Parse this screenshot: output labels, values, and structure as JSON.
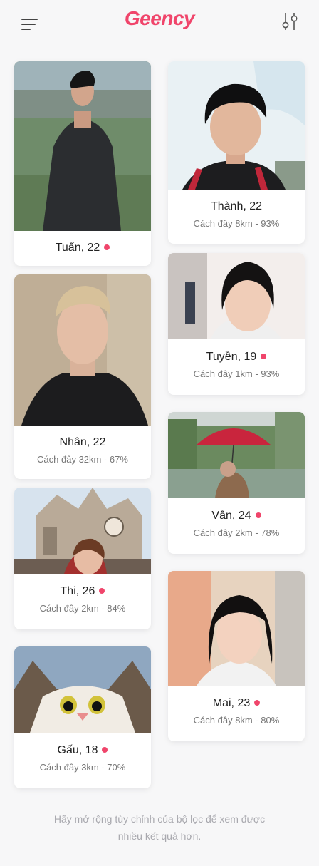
{
  "header": {
    "logo": "Geency",
    "menu_icon": "hamburger-menu-icon",
    "filter_icon": "filter-sliders-icon"
  },
  "colors": {
    "accent": "#f0456b",
    "background": "#f7f7f8"
  },
  "profiles": [
    {
      "name": "Tuấn, 22",
      "online": true
    },
    {
      "name": "Thành, 22",
      "distance": "Cách đây 8km - 93%",
      "online": false
    },
    {
      "name": "Nhân, 22",
      "distance": "Cách đây 32km - 67%",
      "online": false
    },
    {
      "name": "Tuyền, 19",
      "distance": "Cách đây 1km - 93%",
      "online": true
    },
    {
      "name": "Vân, 24",
      "distance": "Cách đây 2km - 78%",
      "online": true
    },
    {
      "name": "Thi, 26",
      "distance": "Cách đây 2km - 84%",
      "online": true
    },
    {
      "name": "Mai, 23",
      "distance": "Cách đây 8km - 80%",
      "online": true
    },
    {
      "name": "Gấu, 18",
      "distance": "Cách đây 3km - 70%",
      "online": true
    }
  ],
  "footer_note": "Hãy mở rộng tùy chỉnh của bộ lọc để xem được nhiều kết quả hơn."
}
